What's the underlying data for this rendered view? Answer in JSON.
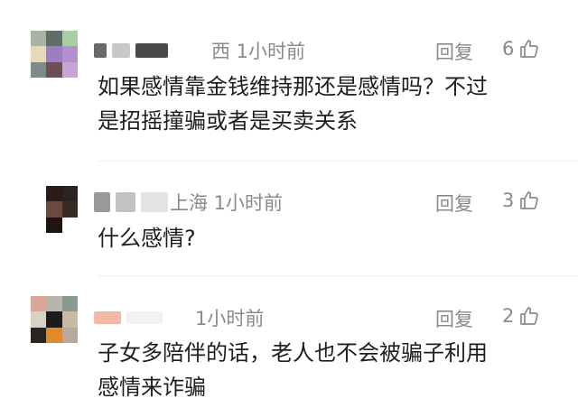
{
  "comments": [
    {
      "location_time": "西 1小时前",
      "reply_label": "回复",
      "like_count": "6",
      "text_lines": [
        "如果感情靠金钱维持那还是感情吗？不过",
        "是招摇撞骗或者是买卖关系"
      ],
      "avatar_colors": [
        "#a9b4a0",
        "#5e6f6a",
        "#a8cfa2",
        "#e6d9b8",
        "#9c7fc2",
        "#b38fd0",
        "#7f8a8d",
        "#6d4f52",
        "#c3a5d8"
      ]
    },
    {
      "location_time": "上海 1小时前",
      "reply_label": "回复",
      "like_count": "3",
      "text_lines": [
        "什么感情?"
      ],
      "avatar_colors": [
        "#ffffff",
        "#2b1c18",
        "#2a2320",
        "#ffffff",
        "#6b4a3d",
        "#3a2a24",
        "#ffffff",
        "#1c1512",
        "#ffffff"
      ]
    },
    {
      "location_time": "1小时前",
      "reply_label": "回复",
      "like_count": "2",
      "text_lines": [
        "子女多陪伴的话，老人也不会被骗子利用",
        "感情来诈骗"
      ],
      "avatar_colors": [
        "#d9a896",
        "#b9b4ac",
        "#8a9b8e",
        "#d8d2c6",
        "#1d1b1a",
        "#c9b9a4",
        "#2a2523",
        "#e08a2a",
        "#b8a8a0"
      ]
    }
  ]
}
